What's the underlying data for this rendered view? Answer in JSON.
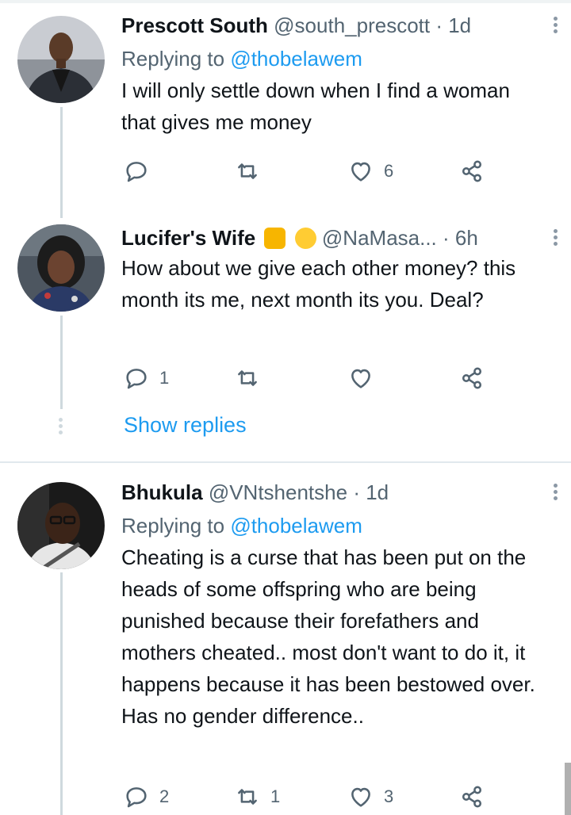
{
  "tweets": [
    {
      "name": "Prescott South",
      "handle": "@south_prescott",
      "time": "· 1d",
      "reply_prefix": "Replying to ",
      "reply_user": "@thobelawem",
      "text": "I will only settle down when I find a woman that gives me money",
      "replies": "",
      "retweets": "",
      "likes": "6"
    },
    {
      "name": "Lucifer's Wife",
      "emojis": [
        "raised-hand-emoji",
        "smirking-face-emoji"
      ],
      "handle": "@NaMasa...",
      "time": "· 6h",
      "text": "How about we give each other money? this month its me, next month its you. Deal?",
      "replies": "1",
      "retweets": "",
      "likes": ""
    },
    {
      "name": "Bhukula",
      "handle": "@VNtshentshe",
      "time": "· 1d",
      "reply_prefix": "Replying to ",
      "reply_user": "@thobelawem",
      "text": "Cheating is a curse that has been put on the heads of some offspring who are being punished because their forefathers and mothers cheated.. most don't want to do it, it happens because it has been bestowed over. Has no gender difference..",
      "replies": "2",
      "retweets": "1",
      "likes": "3"
    }
  ],
  "show_replies": "Show replies",
  "colors": {
    "link": "#1d9bf0",
    "muted": "#536471",
    "text": "#0f1419",
    "thread": "#cfd9de"
  },
  "icons": [
    "reply-icon",
    "retweet-icon",
    "like-icon",
    "share-icon",
    "more-icon"
  ]
}
